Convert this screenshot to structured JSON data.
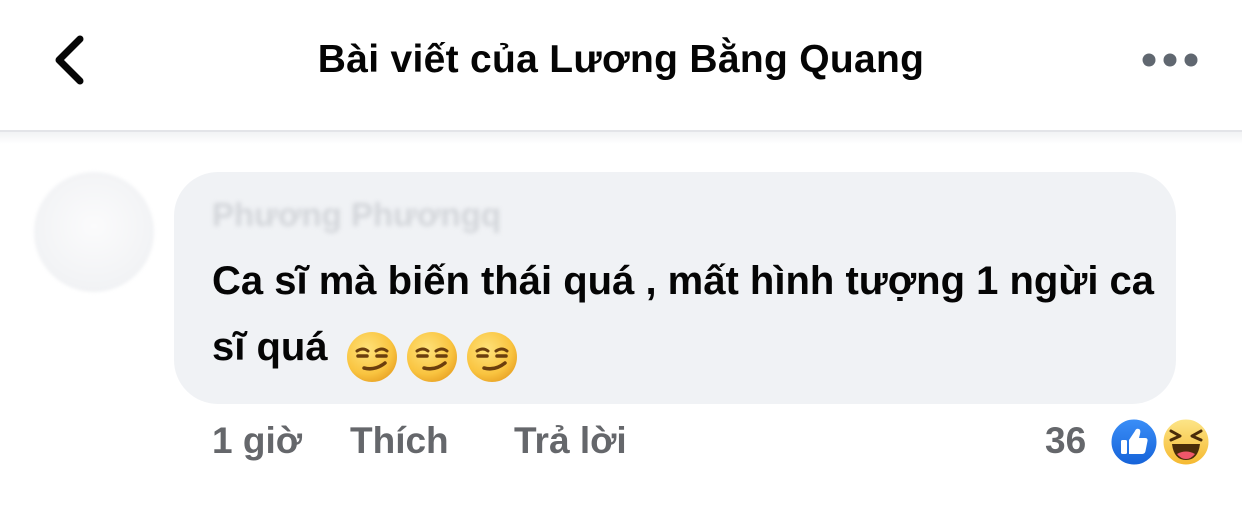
{
  "header": {
    "title": "Bài viết của Lương Bằng Quang",
    "back_icon": "chevron-left-icon",
    "more_icon": "more-horizontal-icon"
  },
  "comment": {
    "author": "Phương Phươngq",
    "text": "Ca sĩ mà biến thái quá , mất hình tượng 1 ngừi ca sĩ quá",
    "emojis": [
      "smirk-emoji",
      "smirk-emoji",
      "smirk-emoji"
    ],
    "time": "1 giờ",
    "like_label": "Thích",
    "reply_label": "Trả lời",
    "reaction_count": "36",
    "reactions": [
      "like-reaction-icon",
      "haha-reaction-icon"
    ]
  },
  "colors": {
    "bubble": "#f0f2f5",
    "text": "#050505",
    "secondary_text": "#65676b",
    "like_blue": "#1877f2",
    "haha_yellow": "#f7c541"
  }
}
